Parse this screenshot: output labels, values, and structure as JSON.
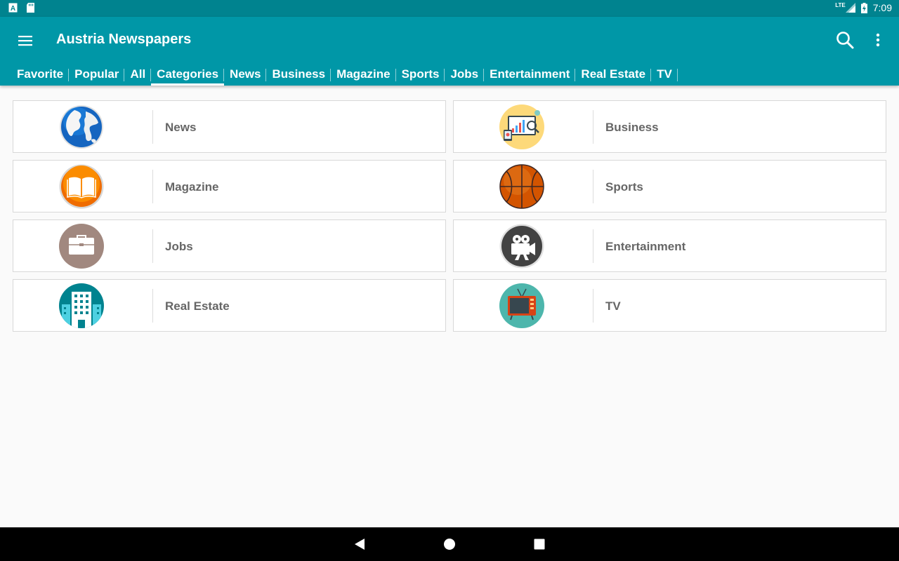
{
  "status_bar": {
    "network": "LTE",
    "time": "7:09"
  },
  "app_bar": {
    "title": "Austria Newspapers",
    "color": "#0097a7"
  },
  "tabs": [
    {
      "label": "Favorite",
      "active": false
    },
    {
      "label": "Popular",
      "active": false
    },
    {
      "label": "All",
      "active": false
    },
    {
      "label": "Categories",
      "active": true
    },
    {
      "label": "News",
      "active": false
    },
    {
      "label": "Business",
      "active": false
    },
    {
      "label": "Magazine",
      "active": false
    },
    {
      "label": "Sports",
      "active": false
    },
    {
      "label": "Jobs",
      "active": false
    },
    {
      "label": "Entertainment",
      "active": false
    },
    {
      "label": "Real Estate",
      "active": false
    },
    {
      "label": "TV",
      "active": false
    }
  ],
  "categories": [
    {
      "label": "News",
      "icon": "globe-icon"
    },
    {
      "label": "Business",
      "icon": "business-chart-icon"
    },
    {
      "label": "Magazine",
      "icon": "book-icon"
    },
    {
      "label": "Sports",
      "icon": "basketball-icon"
    },
    {
      "label": "Jobs",
      "icon": "briefcase-icon"
    },
    {
      "label": "Entertainment",
      "icon": "movie-camera-icon"
    },
    {
      "label": "Real Estate",
      "icon": "building-icon"
    },
    {
      "label": "TV",
      "icon": "tv-icon"
    }
  ]
}
